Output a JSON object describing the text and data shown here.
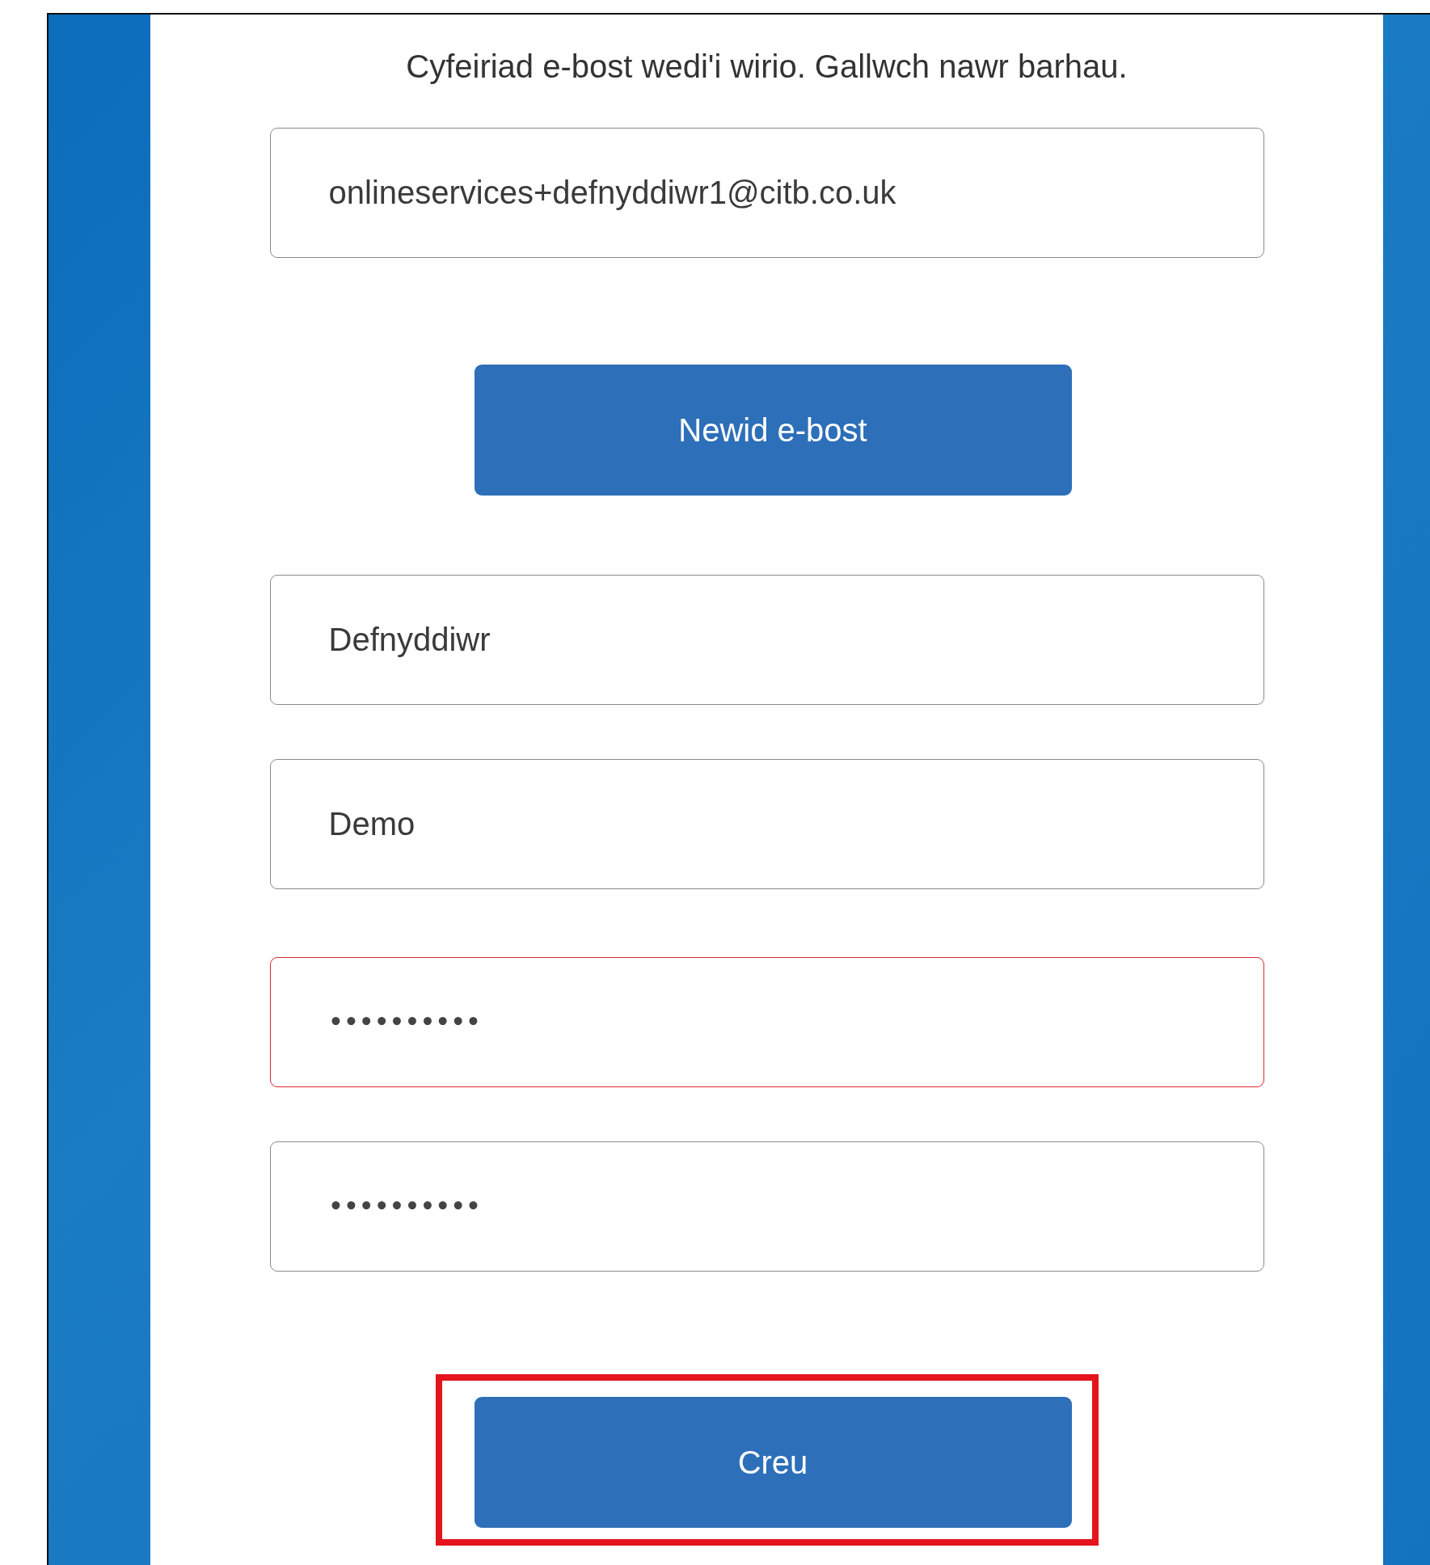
{
  "message": "Cyfeiriad e-bost wedi'i wirio. Gallwch nawr barhau.",
  "email_field": {
    "value": "onlineservices+defnyddiwr1@citb.co.uk",
    "error": false
  },
  "change_email_button": {
    "label": "Newid e-bost",
    "highlighted": false
  },
  "fields": [
    {
      "kind": "text",
      "value": "Defnyddiwr",
      "error": false
    },
    {
      "kind": "text",
      "value": "Demo",
      "error": false
    },
    {
      "kind": "password",
      "value": "••••••••••",
      "error": true
    },
    {
      "kind": "password",
      "value": "••••••••••",
      "error": false
    }
  ],
  "create_button": {
    "label": "Creu",
    "highlighted": true
  }
}
